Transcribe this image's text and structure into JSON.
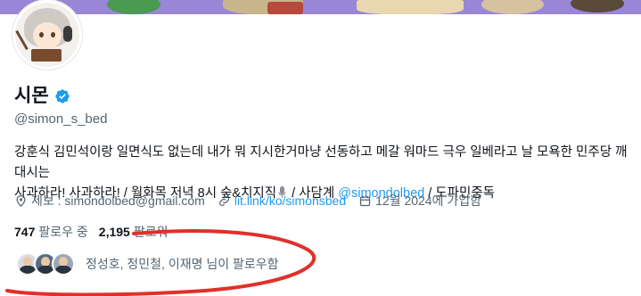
{
  "profile": {
    "name": "시몬",
    "handle": "@simon_s_bed",
    "bio": {
      "line1": "강훈식 김민석이랑 일면식도 없는데 내가 뭐 지시한거마냥 선동하고 메갈 워마드 극우 일베라고 날 모욕한 민주당 깨대시는",
      "line2_a": "사과하라! 사과하라! / 월화목 저녁 8시 숲&치지직",
      "line2_b": " / 사담계 ",
      "mention": "@simondolbed",
      "line2_c": " / 도파민중독"
    },
    "meta": {
      "email": "제보 : simondolbed@gmail.com",
      "link": "lit.link/ko/simonsbed",
      "joined": "12월 2024에 가입함"
    },
    "stats": {
      "following_count": "747",
      "following_label": "팔로우 중",
      "followers_count": "2,195",
      "followers_label": "팔로워"
    },
    "followed_by": "정성호, 정민철, 이재명 님이 팔로우함"
  },
  "colors": {
    "accent": "#1d9bf0",
    "secondary_text": "#536471",
    "annotation": "#e0302a"
  },
  "icons": [
    "verified-badge-icon",
    "location-icon",
    "link-icon",
    "calendar-icon",
    "microphone-icon"
  ]
}
